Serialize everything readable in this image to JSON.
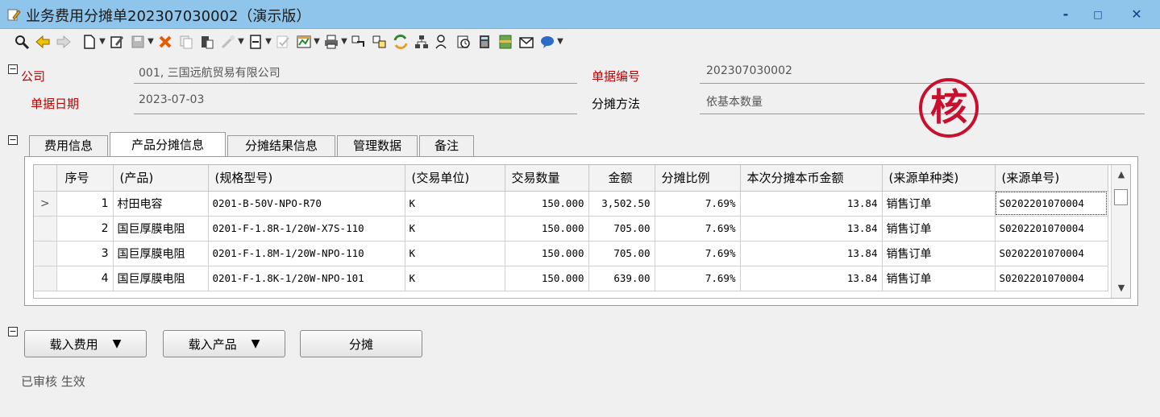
{
  "window": {
    "title": "业务费用分摊单202307030002（演示版）",
    "min_label": "-",
    "max_label": "□",
    "close_label": "✕"
  },
  "toolbar": {
    "icons": [
      "find-icon",
      "back-icon",
      "forward-icon",
      "new-doc-icon",
      "edit-icon",
      "save-icon",
      "delete-icon",
      "copy-icon",
      "paste-icon",
      "link-icon",
      "export-icon",
      "check-icon",
      "chart-icon",
      "print-icon",
      "import-icon",
      "split-icon",
      "refresh-icon",
      "hierarchy-icon",
      "user-search-icon",
      "clock-icon",
      "calculator-icon",
      "notebook-icon",
      "mail-icon",
      "im-icon"
    ]
  },
  "form": {
    "company_label": "公司",
    "company_value": "001, 三国远航贸易有限公司",
    "date_label": "单据日期",
    "date_value": "2023-07-03",
    "docno_label": "单据编号",
    "docno_value": "202307030002",
    "method_label": "分摊方法",
    "method_value": "依基本数量",
    "collapse_glyph": "−"
  },
  "stamp": {
    "text": "核"
  },
  "tabs": [
    {
      "label": "费用信息"
    },
    {
      "label": "产品分摊信息"
    },
    {
      "label": "分摊结果信息"
    },
    {
      "label": "管理数据"
    },
    {
      "label": "备注"
    }
  ],
  "grid": {
    "columns": [
      "序号",
      "(产品)",
      "(规格型号)",
      "(交易单位)",
      "交易数量",
      "金额",
      "分摊比例",
      "本次分摊本币金额",
      "(来源单种类)",
      "(来源单号)"
    ],
    "rows": [
      {
        "marker": ">",
        "no": "1",
        "product": "村田电容",
        "spec": "0201-B-50V-NPO-R70",
        "unit": "K",
        "qty": "150.000",
        "amount": "3,502.50",
        "ratio": "7.69%",
        "alloc": "13.84",
        "src_type": "销售订单",
        "src_no": "S0202201070004"
      },
      {
        "marker": "",
        "no": "2",
        "product": "国巨厚膜电阻",
        "spec": "0201-F-1.8R-1/20W-X7S-110",
        "unit": "K",
        "qty": "150.000",
        "amount": "705.00",
        "ratio": "7.69%",
        "alloc": "13.84",
        "src_type": "销售订单",
        "src_no": "S0202201070004"
      },
      {
        "marker": "",
        "no": "3",
        "product": "国巨厚膜电阻",
        "spec": "0201-F-1.8M-1/20W-NPO-110",
        "unit": "K",
        "qty": "150.000",
        "amount": "705.00",
        "ratio": "7.69%",
        "alloc": "13.84",
        "src_type": "销售订单",
        "src_no": "S0202201070004"
      },
      {
        "marker": "",
        "no": "4",
        "product": "国巨厚膜电阻",
        "spec": "0201-F-1.8K-1/20W-NPO-101",
        "unit": "K",
        "qty": "150.000",
        "amount": "639.00",
        "ratio": "7.69%",
        "alloc": "13.84",
        "src_type": "销售订单",
        "src_no": "S0202201070004"
      }
    ]
  },
  "buttons": {
    "load_fee": "载入费用",
    "load_product": "载入产品",
    "allocate": "分摊",
    "caret": "▼"
  },
  "status": {
    "text": "已审核 生效"
  }
}
